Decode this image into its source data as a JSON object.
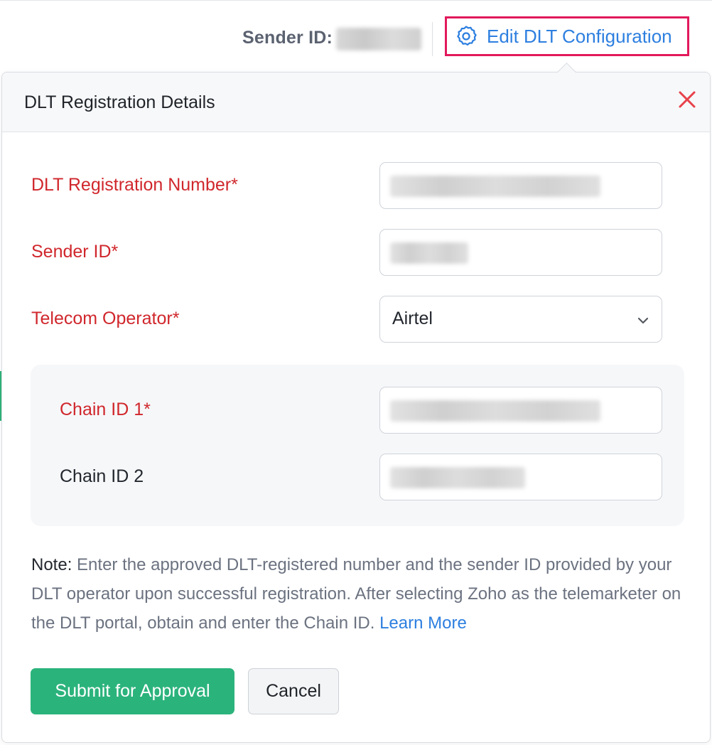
{
  "header": {
    "sender_id_label": "Sender ID:",
    "edit_link_label": "Edit DLT Configuration"
  },
  "dialog": {
    "title": "DLT Registration Details",
    "fields": {
      "registration_number": {
        "label": "DLT Registration Number*"
      },
      "sender_id": {
        "label": "Sender ID*"
      },
      "telecom_operator": {
        "label": "Telecom Operator*",
        "value": "Airtel"
      },
      "chain_id_1": {
        "label": "Chain ID 1*"
      },
      "chain_id_2": {
        "label": "Chain ID 2"
      }
    },
    "note": {
      "head": "Note:",
      "text": " Enter the approved DLT-registered number and the sender ID provided by your DLT operator upon successful registration. After selecting Zoho as the telemarketer on the DLT portal, obtain and enter the Chain ID. ",
      "link": "Learn More"
    },
    "buttons": {
      "submit": "Submit for Approval",
      "cancel": "Cancel"
    }
  },
  "colors": {
    "required_label": "#d0272c",
    "link": "#2d7fe0",
    "primary_button": "#2bb37c",
    "highlight_border": "#e2195c",
    "close_icon": "#e8414a"
  },
  "icons": {
    "edit": "gear-icon",
    "close": "close-icon",
    "select": "chevron-down-icon"
  }
}
